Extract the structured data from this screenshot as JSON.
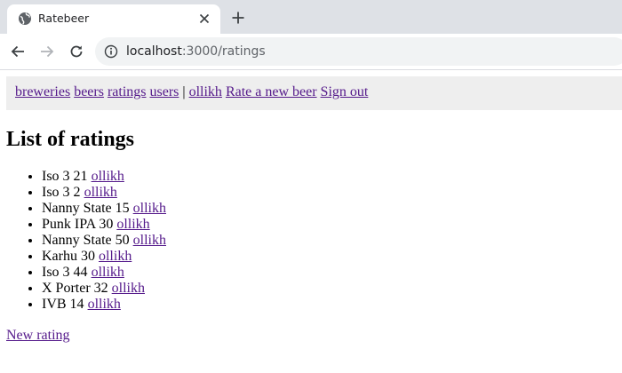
{
  "browser": {
    "tab": {
      "title": "Ratebeer"
    },
    "address_bar": {
      "host": "localhost",
      "rest": ":3000/ratings"
    }
  },
  "navbar": {
    "links": [
      {
        "label": "breweries"
      },
      {
        "label": "beers"
      },
      {
        "label": "ratings"
      },
      {
        "label": "users"
      }
    ],
    "separator": "|",
    "user_link": "ollikh",
    "rate_link": "Rate a new beer",
    "signout_link": "Sign out"
  },
  "page": {
    "heading": "List of ratings",
    "ratings": [
      {
        "text": "Iso 3 21",
        "user": "ollikh"
      },
      {
        "text": "Iso 3 2",
        "user": "ollikh"
      },
      {
        "text": "Nanny State 15",
        "user": "ollikh"
      },
      {
        "text": "Punk IPA 30",
        "user": "ollikh"
      },
      {
        "text": "Nanny State 50",
        "user": "ollikh"
      },
      {
        "text": "Karhu 30",
        "user": "ollikh"
      },
      {
        "text": "Iso 3 44",
        "user": "ollikh"
      },
      {
        "text": "X Porter 32",
        "user": "ollikh"
      },
      {
        "text": "IVB 14",
        "user": "ollikh"
      }
    ],
    "new_rating_link": "New rating"
  }
}
